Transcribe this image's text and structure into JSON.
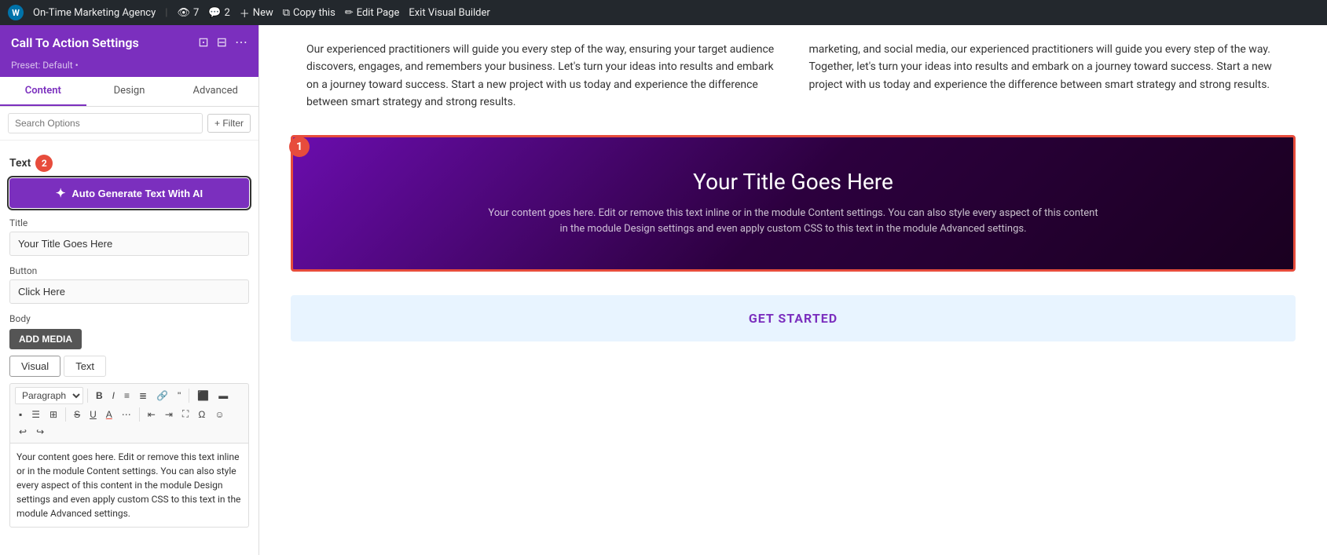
{
  "topbar": {
    "wp_label": "W",
    "site_name": "On-Time Marketing Agency",
    "views": "7",
    "comments": "2",
    "new_label": "New",
    "copy_label": "Copy this",
    "edit_page_label": "Edit Page",
    "exit_label": "Exit Visual Builder"
  },
  "sidebar": {
    "title": "Call To Action Settings",
    "preset": "Preset: Default •",
    "tabs": [
      {
        "label": "Content",
        "id": "content"
      },
      {
        "label": "Design",
        "id": "design"
      },
      {
        "label": "Advanced",
        "id": "advanced"
      }
    ],
    "active_tab": "content",
    "search_placeholder": "Search Options",
    "filter_label": "+ Filter",
    "sections": {
      "text": {
        "label": "Text",
        "badge": "2",
        "ai_button": "Auto Generate Text With AI",
        "title_label": "Title",
        "title_value": "Your Title Goes Here",
        "button_label": "Button",
        "button_value": "Click Here",
        "body_label": "Body",
        "add_media": "ADD MEDIA",
        "visual_tab": "Visual",
        "text_tab": "Text",
        "toolbar": {
          "paragraph": "Paragraph",
          "bold": "B",
          "italic": "I",
          "ul": "≡",
          "ol": "≡",
          "link": "🔗",
          "quote": "❝",
          "align_left": "⬛",
          "align_center": "⬛",
          "align_right": "⬛",
          "align_justify": "⬛",
          "table": "⊞",
          "strikethrough": "S",
          "underline": "U",
          "text_color": "A",
          "more": "⋯",
          "indent_out": "⇤",
          "indent_in": "⇥",
          "fullscreen": "⛶",
          "special_char": "Ω",
          "emoji": "😊",
          "undo": "↩",
          "redo": "↪"
        },
        "body_text": "Your content goes here. Edit or remove this text inline or in the module Content settings. You can also style every aspect of this content in the module Design settings and even apply custom CSS to this text in the module Advanced settings."
      }
    }
  },
  "page": {
    "col1_text": "Our experienced practitioners will guide you every step of the way, ensuring your target audience discovers, engages, and remembers your business. Let's turn your ideas into results and embark on a journey toward success. Start a new project with us today and experience the difference between smart strategy and strong results.",
    "col2_text": "marketing, and social media, our experienced practitioners will guide you every step of the way. Together, let's turn your ideas into results and embark on a journey toward success. Start a new project with us today and experience the difference between smart strategy and strong results.",
    "cta": {
      "badge": "1",
      "title": "Your Title Goes Here",
      "body": "Your content goes here. Edit or remove this text inline or in the module Content settings. You can also style every aspect of this content in the module Design settings and even apply custom CSS to this text in the module Advanced settings."
    },
    "bottom": {
      "label": "GET STARTED"
    }
  }
}
